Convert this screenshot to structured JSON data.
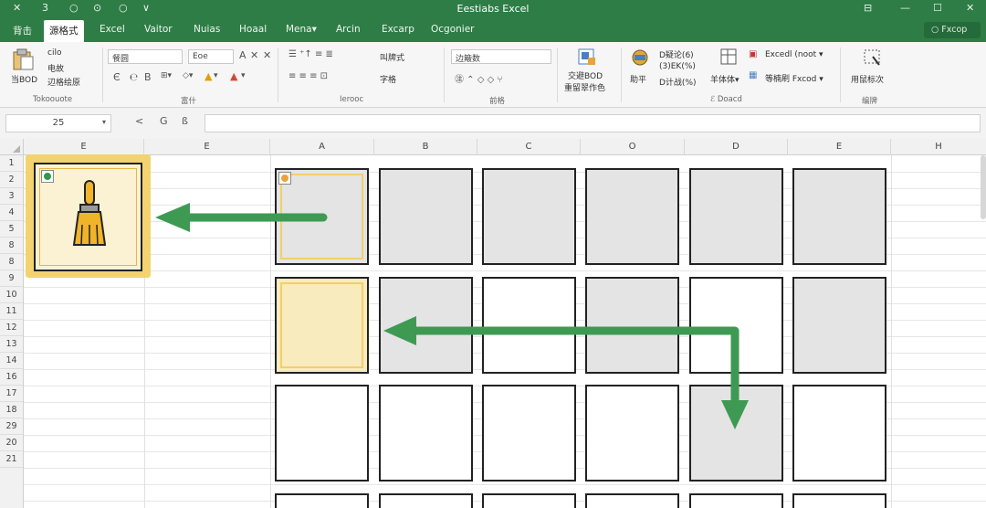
{
  "titlebar": {
    "title": "Eestiabs Excel",
    "quick_access": [
      "✕",
      "3",
      "○",
      "⊙",
      "○",
      "∨"
    ],
    "window_controls": [
      "⊟",
      "—",
      "☐",
      "✕"
    ]
  },
  "tabs": [
    "背击",
    "源格式",
    "Excel",
    "Vaitor",
    "Nuias",
    "Hoaal",
    "Mena▾",
    "Arcin",
    "Excarp",
    "Ocgonier"
  ],
  "active_tab": 1,
  "tab_search": "○ Fxcop",
  "ribbon": {
    "clipboard": {
      "paste_label": "当BOD",
      "cut": "cilo",
      "copy": "电故",
      "format_painter": "辺格绘原",
      "group_label": "Tokoouote"
    },
    "font": {
      "font_name": "餐圆",
      "font_size": "Eoe",
      "group_label": "富什"
    },
    "alignment": {
      "wrap": "叫牌式",
      "merge": "字格",
      "group_label": "Ierooc"
    },
    "number": {
      "format": "边簸数",
      "group_label": "前格"
    },
    "styles": {
      "cond_label": "交避BOD",
      "table_label": "重留翠作色"
    },
    "cells": {
      "insert": "助平",
      "i1": "D疑论(6)",
      "i2": "(3)EK(%)",
      "i3": "D计战(%)",
      "format": "羊体体▾",
      "r1": "Excedl (noot ▾",
      "r2": "等楠刷 Fxcod ▾",
      "group_label": "ℰ Doacd"
    },
    "editing": {
      "label": "用鼠标次",
      "group_label": "编牌"
    }
  },
  "formula_bar": {
    "name_box": "25",
    "buttons": [
      "<",
      "G",
      "ß"
    ],
    "formula": ""
  },
  "sheet": {
    "columns": [
      "E",
      "E",
      "A",
      "B",
      "C",
      "O",
      "D",
      "E",
      "H"
    ],
    "rows": [
      "1",
      "2",
      "3",
      "4",
      "5",
      "8",
      "8",
      "9",
      "10",
      "11",
      "12",
      "13",
      "14",
      "16",
      "17",
      "18",
      "29",
      "20",
      "21"
    ]
  },
  "colors": {
    "green": "#2f7d46",
    "arrow": "#3e9a53",
    "yellow": "#f3d36f",
    "cell_gray": "#e4e4e4"
  },
  "icons": {
    "painter": "paintbrush-icon",
    "arrows": "arrow-icon"
  }
}
